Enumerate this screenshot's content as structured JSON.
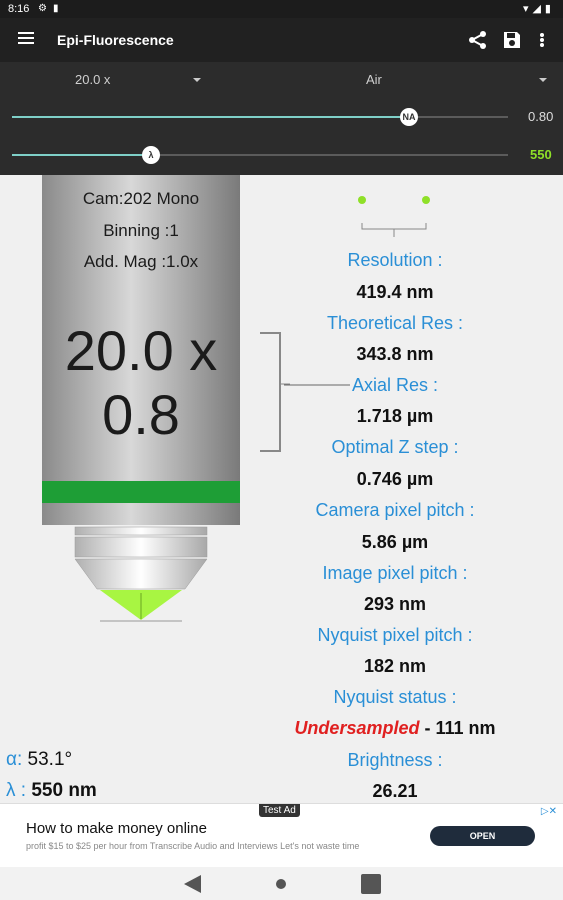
{
  "status": {
    "time": "8:16"
  },
  "toolbar": {
    "title": "Epi-Fluorescence"
  },
  "controls": {
    "magnification": "20.0 x",
    "medium": "Air",
    "na_value": "0.80",
    "na_thumb": "NA",
    "na_fraction": 0.8,
    "wavelength_value": "550",
    "wavelength_thumb": "λ",
    "wavelength_fraction": 0.28
  },
  "objective": {
    "camera": "Cam:202 Mono",
    "binning": "Binning :1",
    "add_mag": "Add. Mag :1.0x",
    "mag_big": "20.0 x",
    "na_big": "0.8",
    "alpha_label": "α:",
    "alpha_value": "53.1°",
    "lambda_label": "λ :",
    "lambda_value": "550 nm"
  },
  "results": {
    "resolution_label": "Resolution :",
    "resolution_value": "419.4 nm",
    "theoretical_label": "Theoretical Res :",
    "theoretical_value": "343.8 nm",
    "axial_label": "Axial Res :",
    "axial_value": "1.718  µm",
    "zstep_label": "Optimal Z step :",
    "zstep_value": "0.746 µm",
    "camera_pitch_label": "Camera pixel pitch :",
    "camera_pitch_value": "5.86 µm",
    "image_pitch_label": "Image pixel pitch :",
    "image_pitch_value": "293 nm",
    "nyquist_pitch_label": "Nyquist pixel pitch :",
    "nyquist_pitch_value": "182 nm",
    "nyquist_status_label": "Nyquist status :",
    "nyquist_status_word": "Undersampled",
    "nyquist_status_value": "-  111 nm",
    "brightness_label": "Brightness :",
    "brightness_value": "26.21"
  },
  "ad": {
    "tag": "Test Ad",
    "headline": "How to make money online",
    "body": "profit $15 to $25 per hour from Transcribe Audio and Interviews Let's not waste time",
    "cta": "OPEN"
  },
  "colors": {
    "accent_green": "#8fe028",
    "band_green": "#1e9e36",
    "label_blue": "#2a8fd6",
    "warn_red": "#e02020"
  }
}
